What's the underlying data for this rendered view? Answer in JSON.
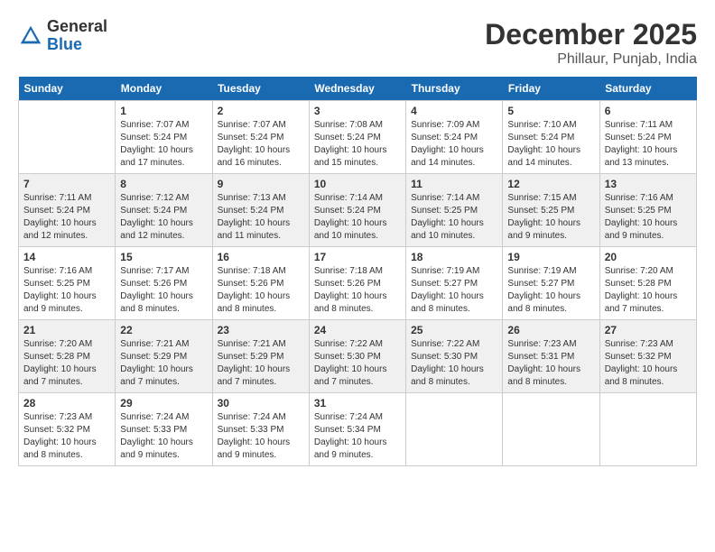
{
  "logo": {
    "general": "General",
    "blue": "Blue"
  },
  "title": {
    "month": "December 2025",
    "location": "Phillaur, Punjab, India"
  },
  "headers": [
    "Sunday",
    "Monday",
    "Tuesday",
    "Wednesday",
    "Thursday",
    "Friday",
    "Saturday"
  ],
  "weeks": [
    [
      {
        "day": "",
        "info": ""
      },
      {
        "day": "1",
        "info": "Sunrise: 7:07 AM\nSunset: 5:24 PM\nDaylight: 10 hours\nand 17 minutes."
      },
      {
        "day": "2",
        "info": "Sunrise: 7:07 AM\nSunset: 5:24 PM\nDaylight: 10 hours\nand 16 minutes."
      },
      {
        "day": "3",
        "info": "Sunrise: 7:08 AM\nSunset: 5:24 PM\nDaylight: 10 hours\nand 15 minutes."
      },
      {
        "day": "4",
        "info": "Sunrise: 7:09 AM\nSunset: 5:24 PM\nDaylight: 10 hours\nand 14 minutes."
      },
      {
        "day": "5",
        "info": "Sunrise: 7:10 AM\nSunset: 5:24 PM\nDaylight: 10 hours\nand 14 minutes."
      },
      {
        "day": "6",
        "info": "Sunrise: 7:11 AM\nSunset: 5:24 PM\nDaylight: 10 hours\nand 13 minutes."
      }
    ],
    [
      {
        "day": "7",
        "info": "Sunrise: 7:11 AM\nSunset: 5:24 PM\nDaylight: 10 hours\nand 12 minutes."
      },
      {
        "day": "8",
        "info": "Sunrise: 7:12 AM\nSunset: 5:24 PM\nDaylight: 10 hours\nand 12 minutes."
      },
      {
        "day": "9",
        "info": "Sunrise: 7:13 AM\nSunset: 5:24 PM\nDaylight: 10 hours\nand 11 minutes."
      },
      {
        "day": "10",
        "info": "Sunrise: 7:14 AM\nSunset: 5:24 PM\nDaylight: 10 hours\nand 10 minutes."
      },
      {
        "day": "11",
        "info": "Sunrise: 7:14 AM\nSunset: 5:25 PM\nDaylight: 10 hours\nand 10 minutes."
      },
      {
        "day": "12",
        "info": "Sunrise: 7:15 AM\nSunset: 5:25 PM\nDaylight: 10 hours\nand 9 minutes."
      },
      {
        "day": "13",
        "info": "Sunrise: 7:16 AM\nSunset: 5:25 PM\nDaylight: 10 hours\nand 9 minutes."
      }
    ],
    [
      {
        "day": "14",
        "info": "Sunrise: 7:16 AM\nSunset: 5:25 PM\nDaylight: 10 hours\nand 9 minutes."
      },
      {
        "day": "15",
        "info": "Sunrise: 7:17 AM\nSunset: 5:26 PM\nDaylight: 10 hours\nand 8 minutes."
      },
      {
        "day": "16",
        "info": "Sunrise: 7:18 AM\nSunset: 5:26 PM\nDaylight: 10 hours\nand 8 minutes."
      },
      {
        "day": "17",
        "info": "Sunrise: 7:18 AM\nSunset: 5:26 PM\nDaylight: 10 hours\nand 8 minutes."
      },
      {
        "day": "18",
        "info": "Sunrise: 7:19 AM\nSunset: 5:27 PM\nDaylight: 10 hours\nand 8 minutes."
      },
      {
        "day": "19",
        "info": "Sunrise: 7:19 AM\nSunset: 5:27 PM\nDaylight: 10 hours\nand 8 minutes."
      },
      {
        "day": "20",
        "info": "Sunrise: 7:20 AM\nSunset: 5:28 PM\nDaylight: 10 hours\nand 7 minutes."
      }
    ],
    [
      {
        "day": "21",
        "info": "Sunrise: 7:20 AM\nSunset: 5:28 PM\nDaylight: 10 hours\nand 7 minutes."
      },
      {
        "day": "22",
        "info": "Sunrise: 7:21 AM\nSunset: 5:29 PM\nDaylight: 10 hours\nand 7 minutes."
      },
      {
        "day": "23",
        "info": "Sunrise: 7:21 AM\nSunset: 5:29 PM\nDaylight: 10 hours\nand 7 minutes."
      },
      {
        "day": "24",
        "info": "Sunrise: 7:22 AM\nSunset: 5:30 PM\nDaylight: 10 hours\nand 7 minutes."
      },
      {
        "day": "25",
        "info": "Sunrise: 7:22 AM\nSunset: 5:30 PM\nDaylight: 10 hours\nand 8 minutes."
      },
      {
        "day": "26",
        "info": "Sunrise: 7:23 AM\nSunset: 5:31 PM\nDaylight: 10 hours\nand 8 minutes."
      },
      {
        "day": "27",
        "info": "Sunrise: 7:23 AM\nSunset: 5:32 PM\nDaylight: 10 hours\nand 8 minutes."
      }
    ],
    [
      {
        "day": "28",
        "info": "Sunrise: 7:23 AM\nSunset: 5:32 PM\nDaylight: 10 hours\nand 8 minutes."
      },
      {
        "day": "29",
        "info": "Sunrise: 7:24 AM\nSunset: 5:33 PM\nDaylight: 10 hours\nand 9 minutes."
      },
      {
        "day": "30",
        "info": "Sunrise: 7:24 AM\nSunset: 5:33 PM\nDaylight: 10 hours\nand 9 minutes."
      },
      {
        "day": "31",
        "info": "Sunrise: 7:24 AM\nSunset: 5:34 PM\nDaylight: 10 hours\nand 9 minutes."
      },
      {
        "day": "",
        "info": ""
      },
      {
        "day": "",
        "info": ""
      },
      {
        "day": "",
        "info": ""
      }
    ]
  ]
}
